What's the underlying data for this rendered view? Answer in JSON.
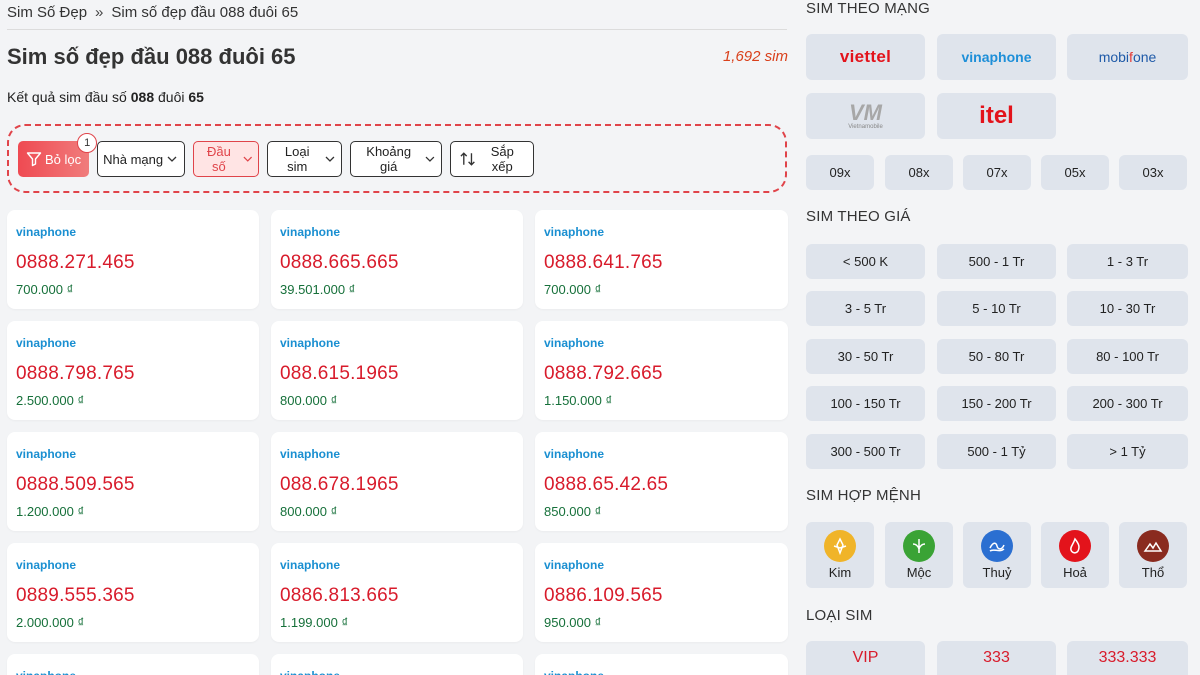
{
  "breadcrumb": {
    "home": "Sim Số Đẹp",
    "sep": "»",
    "current": "Sim số đẹp đầu 088 đuôi 65"
  },
  "title": "Sim số đẹp đầu 088 đuôi 65",
  "count": "1,692 sim",
  "result": {
    "prefix": "Kết quả sim đầu số ",
    "head": "088",
    "mid": " đuôi ",
    "tail": "65"
  },
  "filters": {
    "clear": "Bỏ lọc",
    "badge": "1",
    "network": "Nhà mạng",
    "prefix": "Đầu số",
    "type": "Loại sim",
    "price": "Khoảng giá",
    "sort": "Sắp xếp"
  },
  "sims": [
    {
      "net": "vinaphone",
      "pre": "0888.271.4",
      "suf": "65",
      "price": "700.000 ₫"
    },
    {
      "net": "vinaphone",
      "pre": "0888.665.6",
      "suf": "65",
      "price": "39.501.000 ₫"
    },
    {
      "net": "vinaphone",
      "pre": "0888.641.7",
      "suf": "65",
      "price": "700.000 ₫"
    },
    {
      "net": "vinaphone",
      "pre": "0888.798.7",
      "suf": "65",
      "price": "2.500.000 ₫"
    },
    {
      "net": "vinaphone",
      "pre": "088.615.19",
      "suf": "65",
      "price": "800.000 ₫"
    },
    {
      "net": "vinaphone",
      "pre": "0888.792.6",
      "suf": "65",
      "price": "1.150.000 ₫"
    },
    {
      "net": "vinaphone",
      "pre": "0888.509.5",
      "suf": "65",
      "price": "1.200.000 ₫"
    },
    {
      "net": "vinaphone",
      "pre": "088.678.19",
      "suf": "65",
      "price": "800.000 ₫"
    },
    {
      "net": "vinaphone",
      "pre": "0888.65.42.",
      "suf": "65",
      "price": "850.000 ₫"
    },
    {
      "net": "vinaphone",
      "pre": "0889.555.3",
      "suf": "65",
      "price": "2.000.000 ₫"
    },
    {
      "net": "vinaphone",
      "pre": "0886.813.6",
      "suf": "65",
      "price": "1.199.000 ₫"
    },
    {
      "net": "vinaphone",
      "pre": "0886.109.5",
      "suf": "65",
      "price": "950.000 ₫"
    }
  ],
  "partial_net": "vinaphone",
  "sidebar": {
    "network_title": "SIM THEO MẠNG",
    "networks": {
      "viettel": "viettel",
      "vinaphone": "vinaphone",
      "mobi_a": "mobi",
      "mobi_f": "f",
      "mobi_b": "one",
      "vm": "VM",
      "vm_sub": "Vietnamobile",
      "itel": "itel"
    },
    "prefixes": [
      "09x",
      "08x",
      "07x",
      "05x",
      "03x"
    ],
    "price_title": "SIM THEO GIÁ",
    "prices": [
      "< 500 K",
      "500 - 1 Tr",
      "1 - 3 Tr",
      "3 - 5 Tr",
      "5 - 10 Tr",
      "10 - 30 Tr",
      "30 - 50 Tr",
      "50 - 80 Tr",
      "80 - 100 Tr",
      "100 - 150 Tr",
      "150 - 200 Tr",
      "200 - 300 Tr",
      "300 - 500 Tr",
      "500 - 1 Tỷ",
      "> 1 Tỷ"
    ],
    "menh_title": "SIM HỢP MỆNH",
    "menh": [
      {
        "label": "Kim",
        "color": "#f0b429",
        "icon": "kim-icon"
      },
      {
        "label": "Mộc",
        "color": "#3aa335",
        "icon": "moc-icon"
      },
      {
        "label": "Thuỷ",
        "color": "#2b6fd1",
        "icon": "thuy-icon"
      },
      {
        "label": "Hoả",
        "color": "#e3131b",
        "icon": "hoa-icon"
      },
      {
        "label": "Thổ",
        "color": "#8a2b1f",
        "icon": "tho-icon"
      }
    ],
    "type_title": "LOẠI SIM",
    "types": [
      "VIP",
      "333",
      "333.333"
    ]
  }
}
